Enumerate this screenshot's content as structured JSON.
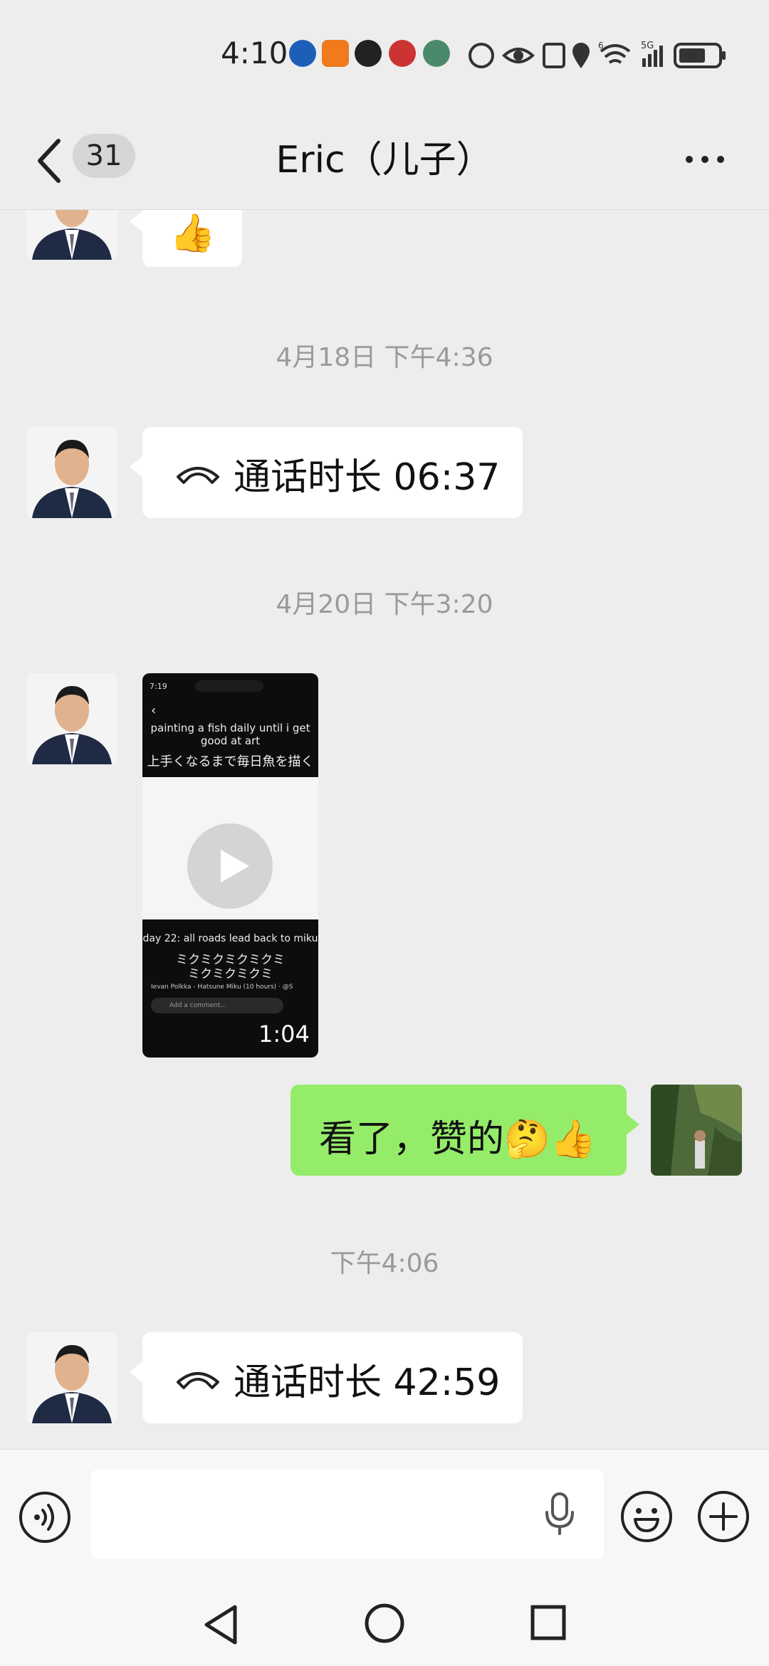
{
  "status_bar": {
    "time": "4:10",
    "network": "5G",
    "signal_label": "6"
  },
  "header": {
    "unread_count": "31",
    "title": "Eric（儿子）"
  },
  "messages": [
    {
      "type": "emoji",
      "side": "left",
      "content": "👍"
    },
    {
      "type": "timestamp",
      "text": "4月18日 下午4:36"
    },
    {
      "type": "call",
      "side": "left",
      "text": "通话时长 06:37"
    },
    {
      "type": "timestamp",
      "text": "4月20日 下午3:20"
    },
    {
      "type": "video",
      "side": "left",
      "duration": "1:04",
      "preview": {
        "time": "7:19",
        "top_caption": "painting a fish daily until i get good at art",
        "jp_caption": "上手くなるまで毎日魚を描く",
        "bottom_caption": "day 22: all roads lead back to miku",
        "jp_lyrics_1": "ミクミクミクミクミ",
        "jp_lyrics_2": "ミクミクミクミ",
        "song": "Ievan Polkka - Hatsune Miku (10 hours) · @Sap...",
        "comment_placeholder": "Add a comment..."
      }
    },
    {
      "type": "text",
      "side": "right",
      "text": "看了，赞的🤔👍"
    },
    {
      "type": "timestamp",
      "text": "下午4:06"
    },
    {
      "type": "call",
      "side": "left",
      "text": "通话时长 42:59"
    }
  ],
  "composer": {
    "input_value": "",
    "placeholder": ""
  },
  "colors": {
    "background": "#ededed",
    "sent_bubble": "#95ec69",
    "received_bubble": "#ffffff",
    "timestamp_text": "#9a9a9a"
  },
  "icons": [
    "back-icon",
    "more-icon",
    "call-icon",
    "play-icon",
    "voice-toggle-icon",
    "microphone-icon",
    "emoji-icon",
    "plus-icon",
    "nav-back-icon",
    "nav-home-icon",
    "nav-recents-icon"
  ]
}
